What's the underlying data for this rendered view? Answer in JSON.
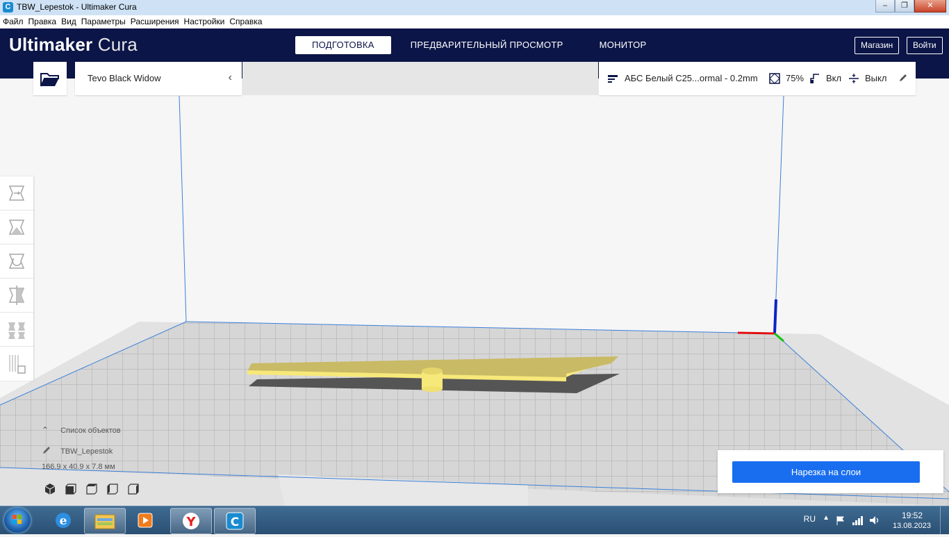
{
  "window": {
    "title": "TBW_Lepestok - Ultimaker Cura"
  },
  "menu": [
    "Файл",
    "Правка",
    "Вид",
    "Параметры",
    "Расширения",
    "Настройки",
    "Справка"
  ],
  "brand": {
    "strong": "Ultimaker",
    "light": "Cura"
  },
  "stages": [
    {
      "label": "ПОДГОТОВКА",
      "active": true
    },
    {
      "label": "ПРЕДВАРИТЕЛЬНЫЙ ПРОСМОТР",
      "active": false
    },
    {
      "label": "МОНИТОР",
      "active": false
    }
  ],
  "header_buttons": {
    "marketplace": "Магазин",
    "signin": "Войти"
  },
  "printer": {
    "name": "Tevo Black Widow"
  },
  "print_settings": {
    "profile": "АБС Белый C25...ormal - 0.2mm",
    "infill": "75%",
    "support": "Вкл",
    "adhesion": "Выкл"
  },
  "object_list": {
    "title": "Список объектов",
    "object_name": "TBW_Lepestok",
    "dimensions": "166.9 x 40.9 x 7.8 мм"
  },
  "slice": {
    "label": "Нарезка на слои"
  },
  "taskbar": {
    "lang": "RU",
    "time": "19:52",
    "date": "13.08.2023"
  },
  "colors": {
    "header": "#0b1547",
    "accent": "#196ef0",
    "model": "#f7e87a",
    "build_line": "#3b7fd9"
  }
}
